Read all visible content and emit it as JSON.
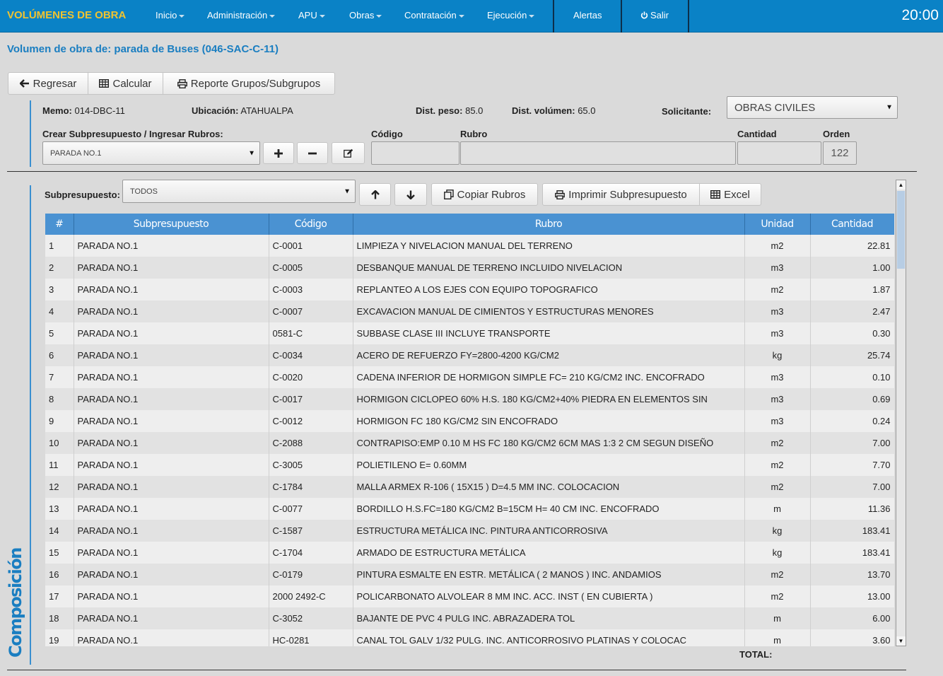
{
  "nav": {
    "brand": "VOLÚMENES DE OBRA",
    "menu": [
      {
        "label": "Inicio",
        "dropdown": true
      },
      {
        "label": "Administración",
        "dropdown": true
      },
      {
        "label": "APU",
        "dropdown": true
      },
      {
        "label": "Obras",
        "dropdown": true
      },
      {
        "label": "Contratación",
        "dropdown": true
      },
      {
        "label": "Ejecución",
        "dropdown": true
      }
    ],
    "alerts": "Alertas",
    "logout": "Salir",
    "time": "20:00"
  },
  "page_title": "Volumen de obra de: parada de Buses (046-SAC-C-11)",
  "toolbar": {
    "back": "Regresar",
    "calculate": "Calcular",
    "report": "Reporte Grupos/Subgrupos"
  },
  "info": {
    "memo_label": "Memo:",
    "memo": "014-DBC-11",
    "ubicacion_label": "Ubicación:",
    "ubicacion": "ATAHUALPA",
    "dist_peso_label": "Dist. peso:",
    "dist_peso": "85.0",
    "dist_volumen_label": "Dist. volúmen:",
    "dist_volumen": "65.0",
    "solicitante_label": "Solicitante:",
    "solicitante": "OBRAS CIVILES"
  },
  "form": {
    "subpresupuesto_label": "Crear Subpresupuesto / Ingresar Rubros:",
    "subpresupuesto_value": "PARADA NO.1",
    "codigo_label": "Código",
    "codigo_value": "",
    "rubro_label": "Rubro",
    "rubro_value": "",
    "cantidad_label": "Cantidad",
    "cantidad_value": "",
    "orden_label": "Orden",
    "orden_value": "122"
  },
  "filter": {
    "label": "Subpresupuesto:",
    "value": "TODOS",
    "copy": "Copiar Rubros",
    "print": "Imprimir Subpresupuesto",
    "excel": "Excel"
  },
  "table": {
    "headers": [
      "#",
      "Subpresupuesto",
      "Código",
      "Rubro",
      "Unidad",
      "Cantidad"
    ],
    "rows": [
      [
        "1",
        "PARADA NO.1",
        "C-0001",
        "LIMPIEZA Y NIVELACION MANUAL DEL TERRENO",
        "m2",
        "22.81"
      ],
      [
        "2",
        "PARADA NO.1",
        "C-0005",
        "DESBANQUE MANUAL DE TERRENO INCLUIDO NIVELACION",
        "m3",
        "1.00"
      ],
      [
        "3",
        "PARADA NO.1",
        "C-0003",
        "REPLANTEO A LOS EJES CON EQUIPO TOPOGRAFICO",
        "m2",
        "1.87"
      ],
      [
        "4",
        "PARADA NO.1",
        "C-0007",
        "EXCAVACION MANUAL DE CIMIENTOS Y ESTRUCTURAS MENORES",
        "m3",
        "2.47"
      ],
      [
        "5",
        "PARADA NO.1",
        "0581-C",
        "SUBBASE CLASE III INCLUYE TRANSPORTE",
        "m3",
        "0.30"
      ],
      [
        "6",
        "PARADA NO.1",
        "C-0034",
        "ACERO DE REFUERZO FY=2800-4200 KG/CM2",
        "kg",
        "25.74"
      ],
      [
        "7",
        "PARADA NO.1",
        "C-0020",
        "CADENA INFERIOR DE HORMIGON SIMPLE FC= 210 KG/CM2 INC. ENCOFRADO",
        "m3",
        "0.10"
      ],
      [
        "8",
        "PARADA NO.1",
        "C-0017",
        "HORMIGON CICLOPEO 60% H.S. 180 KG/CM2+40% PIEDRA EN ELEMENTOS SIN",
        "m3",
        "0.69"
      ],
      [
        "9",
        "PARADA NO.1",
        "C-0012",
        "HORMIGON FC 180 KG/CM2 SIN ENCOFRADO",
        "m3",
        "0.24"
      ],
      [
        "10",
        "PARADA NO.1",
        "C-2088",
        "CONTRAPISO:EMP 0.10 M HS FC 180 KG/CM2 6CM MAS 1:3 2 CM SEGUN DISEÑO",
        "m2",
        "7.00"
      ],
      [
        "11",
        "PARADA NO.1",
        "C-3005",
        "POLIETILENO E= 0.60MM",
        "m2",
        "7.70"
      ],
      [
        "12",
        "PARADA NO.1",
        "C-1784",
        "MALLA ARMEX R-106 ( 15X15 ) D=4.5 MM INC. COLOCACION",
        "m2",
        "7.00"
      ],
      [
        "13",
        "PARADA NO.1",
        "C-0077",
        "BORDILLO H.S.FC=180 KG/CM2 B=15CM H= 40 CM INC. ENCOFRADO",
        "m",
        "11.36"
      ],
      [
        "14",
        "PARADA NO.1",
        "C-1587",
        "ESTRUCTURA METÁLICA INC. PINTURA ANTICORROSIVA",
        "kg",
        "183.41"
      ],
      [
        "15",
        "PARADA NO.1",
        "C-1704",
        "ARMADO DE ESTRUCTURA METÁLICA",
        "kg",
        "183.41"
      ],
      [
        "16",
        "PARADA NO.1",
        "C-0179",
        "PINTURA ESMALTE EN ESTR. METÁLICA ( 2 MANOS ) INC. ANDAMIOS",
        "m2",
        "13.70"
      ],
      [
        "17",
        "PARADA NO.1",
        "2000 2492-C",
        "POLICARBONATO ALVOLEAR 8 MM INC. ACC. INST ( EN CUBIERTA )",
        "m2",
        "13.00"
      ],
      [
        "18",
        "PARADA NO.1",
        "C-3052",
        "BAJANTE DE PVC 4 PULG INC. ABRAZADERA TOL",
        "m",
        "6.00"
      ],
      [
        "19",
        "PARADA NO.1",
        "HC-0281",
        "CANAL TOL GALV 1/32 PULG. INC. ANTICORROSIVO PLATINAS Y COLOCAC",
        "m",
        "3.60"
      ]
    ]
  },
  "total_label": "TOTAL:",
  "section_title": "Composición",
  "colors": {
    "nav": "#0a82c6",
    "brand": "#f0c330",
    "accent": "#1a7ec1",
    "table_header": "#4a92d2"
  }
}
